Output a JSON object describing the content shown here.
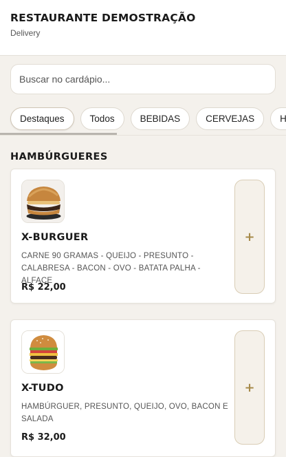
{
  "header": {
    "restaurant_name": "RESTAURANTE DEMOSTRAÇÃO",
    "mode": "Delivery"
  },
  "search": {
    "placeholder": "Buscar no cardápio..."
  },
  "tabs": [
    {
      "label": "Destaques"
    },
    {
      "label": "Todos"
    },
    {
      "label": "BEBIDAS"
    },
    {
      "label": "CERVEJAS"
    },
    {
      "label": "HAMBÚRGUERES"
    }
  ],
  "section": {
    "title": "HAMBÚRGUERES"
  },
  "items": [
    {
      "name": "X-BURGUER",
      "description": "CARNE 90 GRAMAS - QUEIJO - PRESUNTO - CALABRESA - BACON - OVO - BATATA PALHA - ALFACE",
      "price": "R$ 22,00",
      "add_label": "+",
      "image_icon": "burger-photo"
    },
    {
      "name": "X-TUDO",
      "description": "HAMBÚRGUER, PRESUNTO, QUEIJO, OVO, BACON E SALADA",
      "price": "R$ 32,00",
      "add_label": "+",
      "image_icon": "burger-photo"
    }
  ],
  "colors": {
    "background": "#f4f1ec",
    "accent": "#a68a4a",
    "add_button_bg": "#f5f1ea"
  }
}
